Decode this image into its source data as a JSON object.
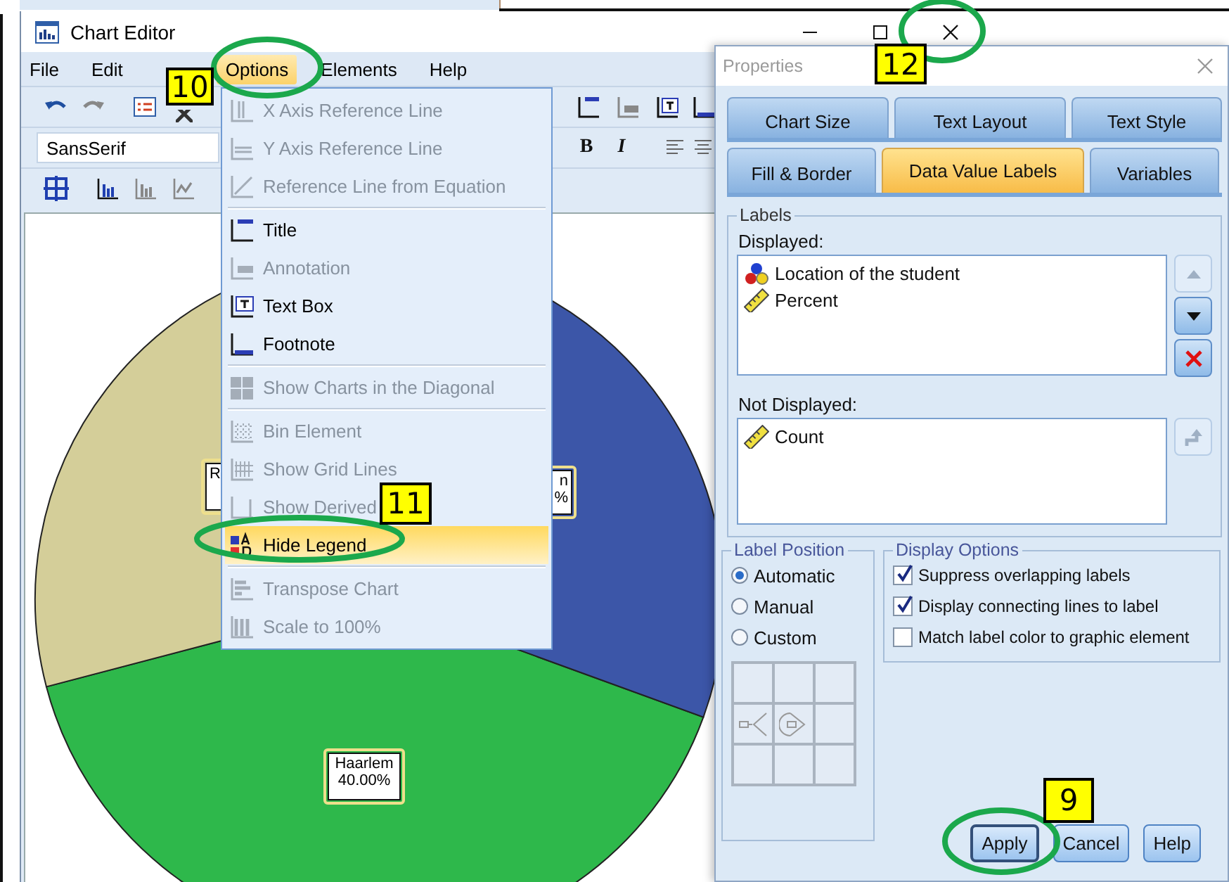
{
  "chart_editor": {
    "title": "Chart Editor",
    "menu": [
      {
        "label": "File",
        "selected": false
      },
      {
        "label": "Edit",
        "selected": false
      },
      {
        "label": "Options",
        "selected": true
      },
      {
        "label": "Elements",
        "selected": false
      },
      {
        "label": "Help",
        "selected": false
      }
    ],
    "font_field": {
      "value": "SansSerif"
    },
    "format_buttons": [
      "B",
      "I"
    ],
    "chart_labels": [
      {
        "text": "R"
      },
      {
        "text": "n\n%"
      },
      {
        "text": "Haarlem\n40.00%"
      }
    ],
    "options_menu": {
      "groups": [
        [
          {
            "label": "X Axis Reference Line",
            "disabled": true,
            "selected": false
          },
          {
            "label": "Y Axis Reference Line",
            "disabled": true,
            "selected": false
          },
          {
            "label": "Reference Line from Equation",
            "disabled": true,
            "selected": false
          }
        ],
        [
          {
            "label": "Title",
            "disabled": false,
            "selected": false
          },
          {
            "label": "Annotation",
            "disabled": true,
            "selected": false
          },
          {
            "label": "Text Box",
            "disabled": false,
            "selected": false
          },
          {
            "label": "Footnote",
            "disabled": false,
            "selected": false
          }
        ],
        [
          {
            "label": "Show Charts in the Diagonal",
            "disabled": true,
            "selected": false
          }
        ],
        [
          {
            "label": "Bin Element",
            "disabled": true,
            "selected": false
          },
          {
            "label": "Show Grid Lines",
            "disabled": true,
            "selected": false
          },
          {
            "label": "Show Derived",
            "disabled": true,
            "selected": false
          },
          {
            "label": "Hide Legend",
            "disabled": false,
            "selected": true
          }
        ],
        [
          {
            "label": "Transpose Chart",
            "disabled": true,
            "selected": false
          },
          {
            "label": "Scale to 100%",
            "disabled": true,
            "selected": false
          }
        ]
      ]
    }
  },
  "properties": {
    "title": "Properties",
    "tab_rows": [
      [
        {
          "label": "Chart Size",
          "selected": false
        },
        {
          "label": "Text Layout",
          "selected": false
        },
        {
          "label": "Text Style",
          "selected": false
        }
      ],
      [
        {
          "label": "Fill & Border",
          "selected": false
        },
        {
          "label": "Data Value Labels",
          "selected": true
        },
        {
          "label": "Variables",
          "selected": false
        }
      ]
    ],
    "labels_group": {
      "title": "Labels",
      "displayed_label": "Displayed:",
      "displayed": [
        {
          "label": "Location of the student",
          "kind": "nominal"
        },
        {
          "label": "Percent",
          "kind": "scale"
        }
      ],
      "displayed_buttons": [
        {
          "kind": "up",
          "disabled": true
        },
        {
          "kind": "down",
          "disabled": false
        },
        {
          "kind": "remove",
          "disabled": false
        }
      ],
      "not_displayed_label": "Not Displayed:",
      "not_displayed": [
        {
          "label": "Count",
          "kind": "scale"
        }
      ],
      "not_displayed_buttons": [
        {
          "kind": "move_up",
          "disabled": true
        }
      ]
    },
    "label_position": {
      "title": "Label Position",
      "options": [
        {
          "label": "Automatic",
          "selected": true
        },
        {
          "label": "Manual",
          "selected": false
        },
        {
          "label": "Custom",
          "selected": false
        }
      ]
    },
    "display_options": {
      "title": "Display Options",
      "options": [
        {
          "label": "Suppress overlapping labels",
          "checked": true
        },
        {
          "label": "Display connecting lines to label",
          "checked": true
        },
        {
          "label": "Match label color to graphic element",
          "checked": false
        }
      ]
    },
    "buttons": [
      "Apply",
      "Cancel",
      "Help"
    ]
  },
  "callouts": [
    {
      "label": "10"
    },
    {
      "label": "12"
    },
    {
      "label": "11"
    },
    {
      "label": "9"
    }
  ]
}
